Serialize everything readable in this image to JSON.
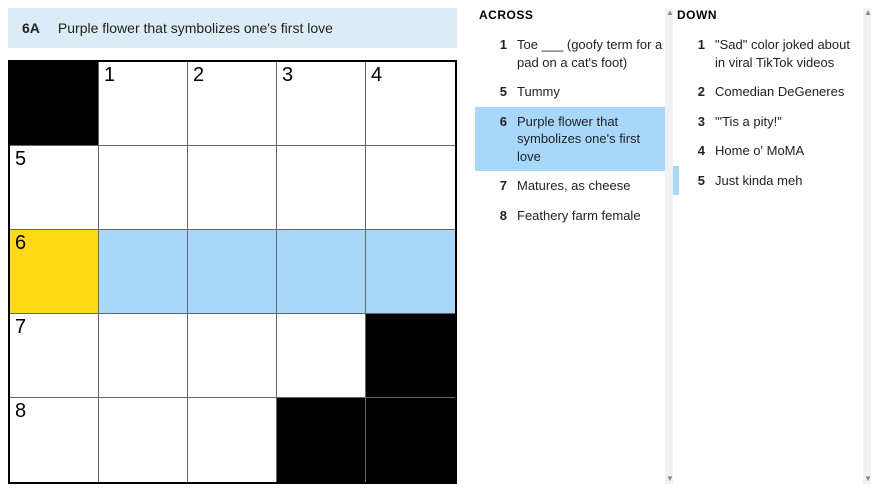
{
  "current_clue": {
    "label": "6A",
    "text": "Purple flower that symbolizes one's first love"
  },
  "grid": {
    "rows": 5,
    "cols": 5,
    "cells": [
      [
        {
          "black": true
        },
        {
          "num": "1"
        },
        {
          "num": "2"
        },
        {
          "num": "3"
        },
        {
          "num": "4"
        }
      ],
      [
        {
          "num": "5"
        },
        {},
        {},
        {},
        {}
      ],
      [
        {
          "num": "6",
          "active": true
        },
        {
          "hl": true
        },
        {
          "hl": true
        },
        {
          "hl": true
        },
        {
          "hl": true
        }
      ],
      [
        {
          "num": "7"
        },
        {},
        {},
        {},
        {
          "black": true
        }
      ],
      [
        {
          "num": "8"
        },
        {},
        {},
        {
          "black": true
        },
        {
          "black": true
        }
      ]
    ]
  },
  "across": {
    "title": "ACROSS",
    "clues": [
      {
        "num": "1",
        "text": "Toe ___ (goofy term for a pad on a cat's foot)"
      },
      {
        "num": "5",
        "text": "Tummy"
      },
      {
        "num": "6",
        "text": "Purple flower that symbolizes one's first love",
        "selected": true
      },
      {
        "num": "7",
        "text": "Matures, as cheese"
      },
      {
        "num": "8",
        "text": "Feathery farm female"
      }
    ]
  },
  "down": {
    "title": "DOWN",
    "clues": [
      {
        "num": "1",
        "text": "\"Sad\" color joked about in viral TikTok videos"
      },
      {
        "num": "2",
        "text": "Comedian DeGeneres"
      },
      {
        "num": "3",
        "text": "\"'Tis a pity!\""
      },
      {
        "num": "4",
        "text": "Home o' MoMA"
      },
      {
        "num": "5",
        "text": "Just kinda meh",
        "related": true
      }
    ]
  },
  "chart_data": {
    "type": "table",
    "title": "NYT Mini Crossword 5x5",
    "grid_size": [
      5,
      5
    ],
    "black_squares": [
      [
        0,
        0
      ],
      [
        3,
        4
      ],
      [
        4,
        3
      ],
      [
        4,
        4
      ]
    ],
    "numbering": {
      "1": [
        0,
        1
      ],
      "2": [
        0,
        2
      ],
      "3": [
        0,
        3
      ],
      "4": [
        0,
        4
      ],
      "5": [
        1,
        0
      ],
      "6": [
        2,
        0
      ],
      "7": [
        3,
        0
      ],
      "8": [
        4,
        0
      ]
    },
    "highlighted_row": 2,
    "active_cell": [
      2,
      0
    ]
  }
}
